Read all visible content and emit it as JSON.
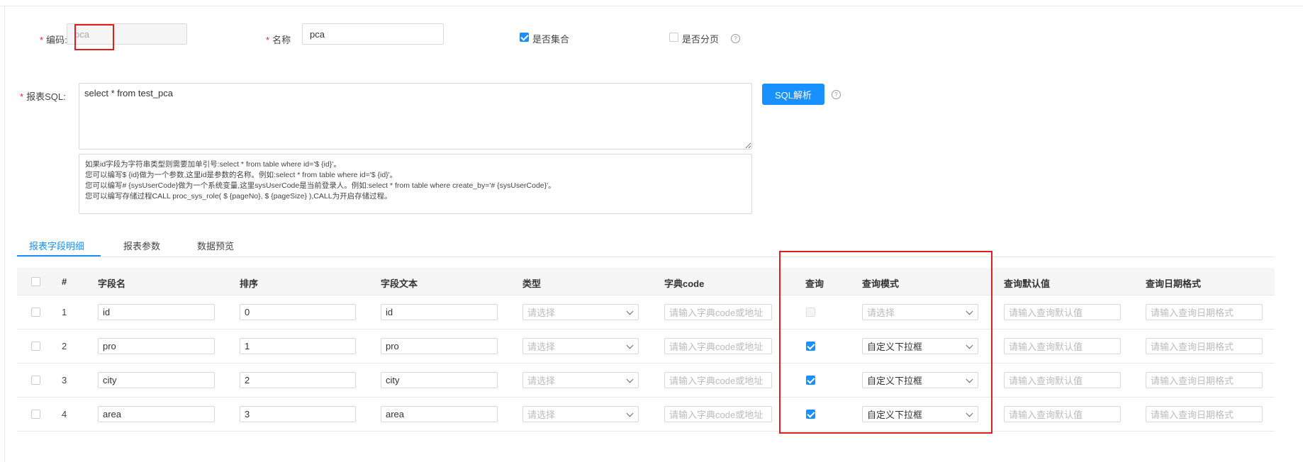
{
  "form": {
    "code_label": "编码:",
    "code_value": "pca",
    "name_label": "名称",
    "name_value": "pca",
    "is_collection_label": "是否集合",
    "is_paging_label": "是否分页",
    "sql_label": "报表SQL:",
    "sql_value": "select * from test_pca",
    "sql_parse_button": "SQL解析",
    "help_glyph": "?",
    "tips": [
      "如果id字段为字符串类型则需要加单引号:select * from table where id='$ {id}'。",
      "您可以编写$ {id}做为一个参数,这里id是参数的名称。例如:select * from table where id='$ {id}'。",
      "您可以编写# {sysUserCode}做为一个系统变量,这里sysUserCode是当前登录人。例如:select * from table where create_by='# {sysUserCode}'。",
      "您可以编写存储过程CALL proc_sys_role( $ {pageNo}, $ {pageSize} ),CALL为开启存储过程。"
    ]
  },
  "tabs": [
    "报表字段明细",
    "报表参数",
    "数据预览"
  ],
  "table": {
    "headers": {
      "index": "#",
      "field_name": "字段名",
      "order": "排序",
      "field_text": "字段文本",
      "type": "类型",
      "dict_code": "字典code",
      "query": "查询",
      "query_mode": "查询模式",
      "query_default": "查询默认值",
      "query_date_format": "查询日期格式"
    },
    "placeholders": {
      "type": "请选择",
      "dict_code": "请输入字典code或地址",
      "query_default": "请输入查询默认值",
      "query_date_format": "请输入查询日期格式"
    },
    "rows": [
      {
        "index": "1",
        "field_name": "id",
        "order": "0",
        "field_text": "id",
        "query": false,
        "query_mode": "请选择"
      },
      {
        "index": "2",
        "field_name": "pro",
        "order": "1",
        "field_text": "pro",
        "query": true,
        "query_mode": "自定义下拉框"
      },
      {
        "index": "3",
        "field_name": "city",
        "order": "2",
        "field_text": "city",
        "query": true,
        "query_mode": "自定义下拉框"
      },
      {
        "index": "4",
        "field_name": "area",
        "order": "3",
        "field_text": "area",
        "query": true,
        "query_mode": "自定义下拉框"
      }
    ]
  },
  "colors": {
    "accent": "#1890ff",
    "highlight": "#e01e1e"
  }
}
